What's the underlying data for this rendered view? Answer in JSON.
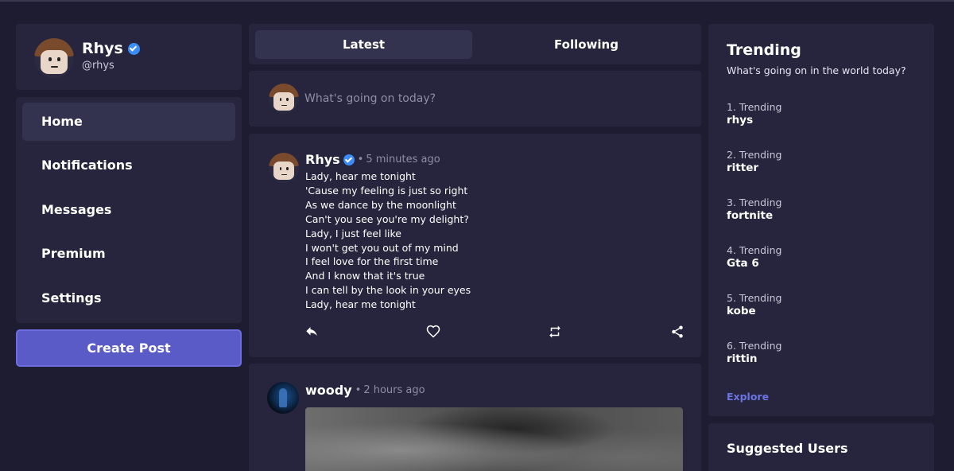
{
  "profile": {
    "name": "Rhys",
    "handle": "@rhys"
  },
  "nav": {
    "items": [
      {
        "label": "Home",
        "active": true
      },
      {
        "label": "Notifications"
      },
      {
        "label": "Messages"
      },
      {
        "label": "Premium"
      },
      {
        "label": "Settings"
      }
    ],
    "create_post": "Create Post"
  },
  "feed": {
    "tabs": [
      {
        "label": "Latest",
        "active": true
      },
      {
        "label": "Following"
      }
    ],
    "composer_placeholder": "What's going on today?",
    "posts": [
      {
        "author": "Rhys",
        "verified": true,
        "separator": "•",
        "time": "5 minutes ago",
        "lines": [
          "Lady, hear me tonight",
          "'Cause my feeling is just so right",
          "As we dance by the moonlight",
          "Can't you see you're my delight?",
          "Lady, I just feel like",
          "I won't get you out of my mind",
          "I feel love for the first time",
          "And I know that it's true",
          "I can tell by the look in your eyes",
          "Lady, hear me tonight"
        ],
        "actions": [
          "reply-icon",
          "heart-icon",
          "repost-icon",
          "share-icon"
        ]
      },
      {
        "author": "woody",
        "separator": "•",
        "time": "2 hours ago"
      }
    ]
  },
  "trending": {
    "title": "Trending",
    "subtitle": "What's going on in the world today?",
    "items": [
      {
        "rank": "1. Trending",
        "topic": "rhys"
      },
      {
        "rank": "2. Trending",
        "topic": "ritter"
      },
      {
        "rank": "3. Trending",
        "topic": "fortnite"
      },
      {
        "rank": "4. Trending",
        "topic": "Gta 6"
      },
      {
        "rank": "5. Trending",
        "topic": "kobe"
      },
      {
        "rank": "6. Trending",
        "topic": "rittin"
      }
    ],
    "explore": "Explore"
  },
  "suggested": {
    "title": "Suggested Users"
  },
  "colors": {
    "background": "#1d1c31",
    "panel": "#26253d",
    "active": "#33324f",
    "accent": "#5b5bc7",
    "verified": "#3b8cf6",
    "link": "#6b74e2"
  }
}
